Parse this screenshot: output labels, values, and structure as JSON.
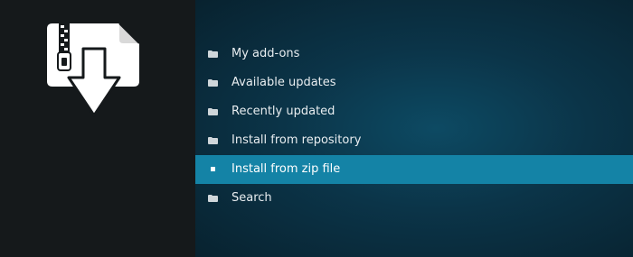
{
  "sidebar": {
    "icon": "zip-install-icon"
  },
  "menu": {
    "items": [
      {
        "label": "My add-ons",
        "icon": "folder-icon"
      },
      {
        "label": "Available updates",
        "icon": "folder-icon"
      },
      {
        "label": "Recently updated",
        "icon": "folder-icon"
      },
      {
        "label": "Install from repository",
        "icon": "folder-icon"
      },
      {
        "label": "Install from zip file",
        "icon": "bullet-icon",
        "selected": true
      },
      {
        "label": "Search",
        "icon": "folder-icon"
      }
    ]
  },
  "colors": {
    "selected_background": "#1483a6",
    "sidebar_background": "#15191b",
    "main_background": "#0b3448"
  }
}
